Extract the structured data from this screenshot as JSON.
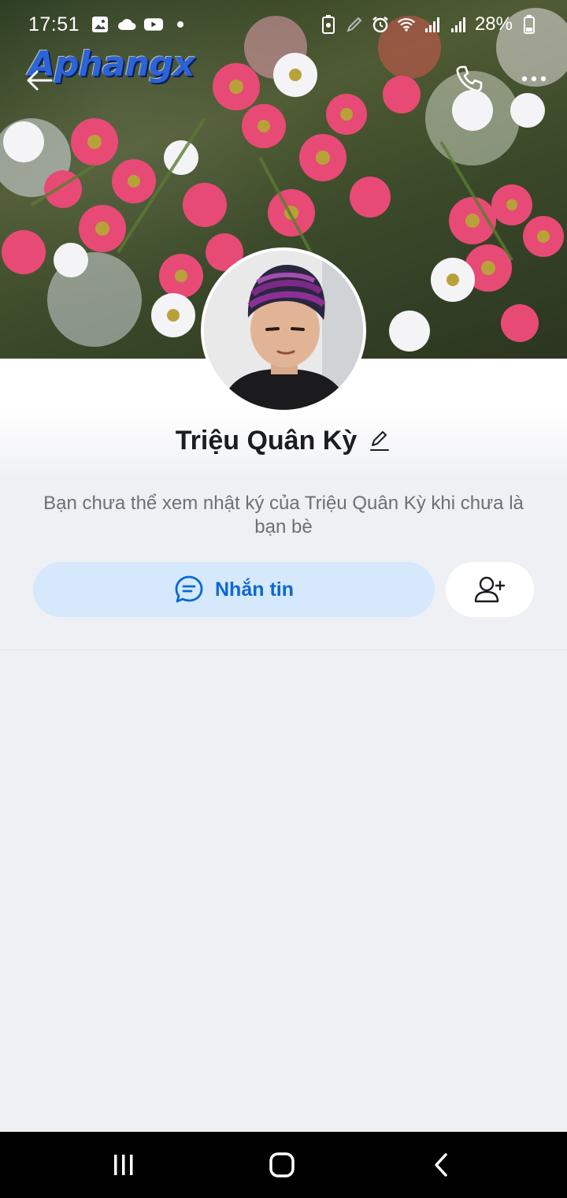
{
  "status_bar": {
    "time": "17:51",
    "battery": "28%",
    "left_icons": [
      "gallery-icon",
      "cloud-icon",
      "youtube-icon",
      "dot-icon"
    ],
    "right_icons": [
      "battery-saver-icon",
      "pen-icon",
      "alarm-icon",
      "wifi-icon",
      "signal-icon",
      "signal-icon",
      "battery-icon"
    ]
  },
  "watermark": "Aphangx",
  "profile": {
    "name": "Triệu Quân Kỳ",
    "privacy_note": "Bạn chưa thể xem nhật ký của Triệu Quân Kỳ khi chưa là bạn bè"
  },
  "actions": {
    "message_label": "Nhắn tin"
  },
  "colors": {
    "accent": "#0a68d3",
    "message_button_bg": "#d5e8fc",
    "background": "#eff0f4"
  }
}
